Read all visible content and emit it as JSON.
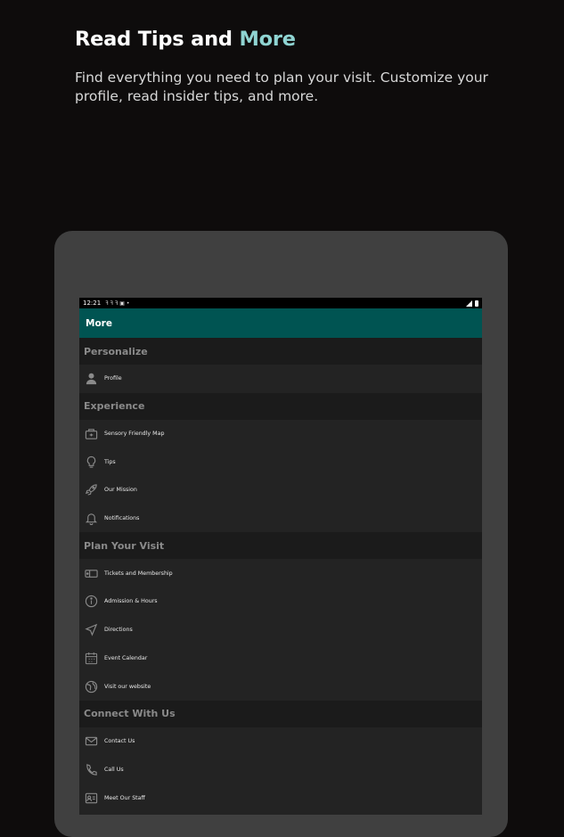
{
  "promo": {
    "title_main": "Read Tips and ",
    "title_accent": "More",
    "subtitle": "Find everything you need to plan your visit. Customize your profile, read insider tips, and more."
  },
  "status_bar": {
    "time": "12:21"
  },
  "appbar": {
    "title": "More"
  },
  "colors": {
    "accent": "#8fd4d2",
    "appbar": "#005452",
    "background": "#0e0c0c"
  },
  "sections": [
    {
      "header": "Personalize",
      "items": [
        {
          "label": "Profile",
          "icon": "person-icon"
        }
      ]
    },
    {
      "header": "Experience",
      "items": [
        {
          "label": "Sensory Friendly Map",
          "icon": "map-icon"
        },
        {
          "label": "Tips",
          "icon": "lightbulb-icon"
        },
        {
          "label": "Our Mission",
          "icon": "rocket-icon"
        },
        {
          "label": "Notifications",
          "icon": "bell-icon"
        }
      ]
    },
    {
      "header": "Plan Your Visit",
      "items": [
        {
          "label": "Tickets and Membership",
          "icon": "ticket-icon"
        },
        {
          "label": "Admission & Hours",
          "icon": "info-icon"
        },
        {
          "label": "Directions",
          "icon": "navigation-icon"
        },
        {
          "label": "Event Calendar",
          "icon": "calendar-icon"
        },
        {
          "label": "Visit our website",
          "icon": "globe-icon"
        }
      ]
    },
    {
      "header": "Connect With Us",
      "items": [
        {
          "label": "Contact Us",
          "icon": "mail-icon"
        },
        {
          "label": "Call Us",
          "icon": "phone-icon"
        },
        {
          "label": "Meet Our Staff",
          "icon": "staff-icon"
        }
      ]
    }
  ]
}
